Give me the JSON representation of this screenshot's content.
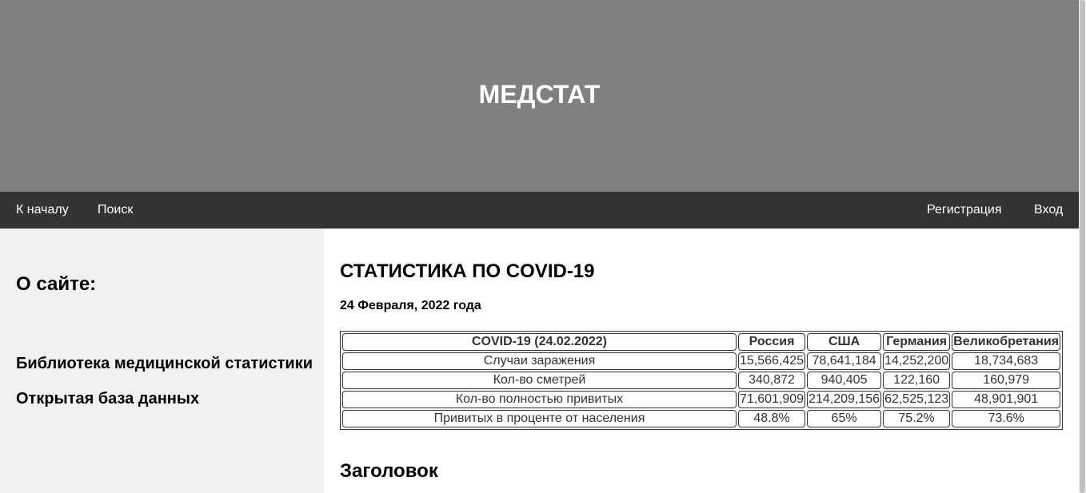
{
  "header": {
    "site_title": "МЕДСТАТ"
  },
  "nav": {
    "home": "К началу",
    "search": "Поиск",
    "register": "Регистрация",
    "login": "Вход"
  },
  "sidebar": {
    "heading": "О сайте:",
    "links": [
      "Библиотека медицинской статистики",
      "Открытая база данных"
    ]
  },
  "main": {
    "title": "СТАТИСТИКА ПО COVID-19",
    "date": "24 Февраля, 2022 года",
    "subheading": "Заголовок",
    "table": {
      "headers": [
        "COVID-19 (24.02.2022)",
        "Россия",
        "США",
        "Германия",
        "Великобретания"
      ],
      "rows": [
        [
          "Случаи заражения",
          "15,566,425",
          "78,641,184",
          "14,252,200",
          "18,734,683"
        ],
        [
          "Кол-во сметрей",
          "340,872",
          "940,405",
          "122,160",
          "160,979"
        ],
        [
          "Кол-во полностью привитых",
          "71,601,909",
          "214,209,156",
          "62,525,123",
          "48,901,901"
        ],
        [
          "Привитых в проценте от населения",
          "48.8%",
          "65%",
          "75.2%",
          "73.6%"
        ]
      ]
    }
  },
  "colors": {
    "header_bg": "#808080",
    "nav_bg": "#333333",
    "sidebar_bg": "#f1f1f1"
  }
}
